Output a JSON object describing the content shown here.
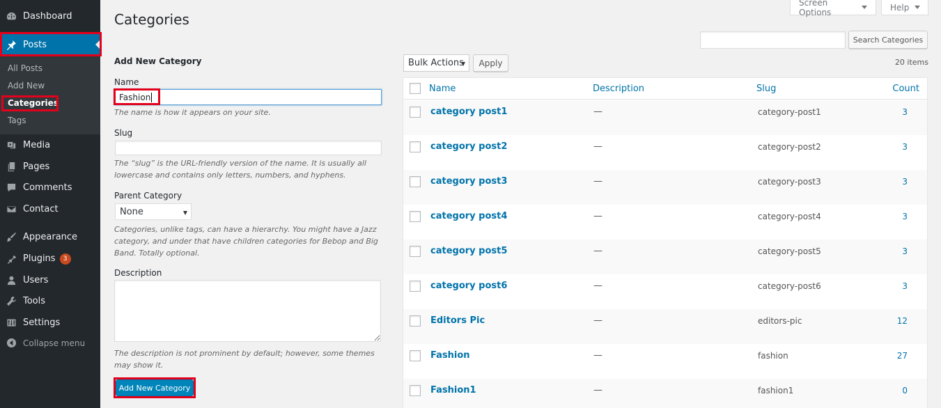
{
  "sidebar": {
    "dashboard": "Dashboard",
    "posts": "Posts",
    "submenu": [
      "All Posts",
      "Add New",
      "Categories",
      "Tags"
    ],
    "media": "Media",
    "pages": "Pages",
    "comments": "Comments",
    "contact": "Contact",
    "appearance": "Appearance",
    "plugins": "Plugins",
    "plugins_badge": "3",
    "users": "Users",
    "tools": "Tools",
    "settings": "Settings",
    "collapse": "Collapse menu"
  },
  "header": {
    "title": "Categories",
    "screen_options": "Screen Options",
    "help": "Help",
    "search_value": "",
    "search_button": "Search Categories"
  },
  "form": {
    "heading": "Add New Category",
    "name_label": "Name",
    "name_value": "Fashion",
    "name_help": "The name is how it appears on your site.",
    "slug_label": "Slug",
    "slug_value": "",
    "slug_help": "The “slug” is the URL-friendly version of the name. It is usually all lowercase and contains only letters, numbers, and hyphens.",
    "parent_label": "Parent Category",
    "parent_value": "None",
    "parent_help": "Categories, unlike tags, can have a hierarchy. You might have a Jazz category, and under that have children categories for Bebop and Big Band. Totally optional.",
    "description_label": "Description",
    "description_value": "",
    "description_help": "The description is not prominent by default; however, some themes may show it.",
    "submit": "Add New Category"
  },
  "table": {
    "bulk_actions": "Bulk Actions",
    "apply": "Apply",
    "items_count": "20 items",
    "columns": {
      "name": "Name",
      "description": "Description",
      "slug": "Slug",
      "count": "Count"
    },
    "rows": [
      {
        "name": "category post1",
        "description": "—",
        "slug": "category-post1",
        "count": "3"
      },
      {
        "name": "category post2",
        "description": "—",
        "slug": "category-post2",
        "count": "3"
      },
      {
        "name": "category post3",
        "description": "—",
        "slug": "category-post3",
        "count": "3"
      },
      {
        "name": "category post4",
        "description": "—",
        "slug": "category-post4",
        "count": "3"
      },
      {
        "name": "category post5",
        "description": "—",
        "slug": "category-post5",
        "count": "3"
      },
      {
        "name": "category post6",
        "description": "—",
        "slug": "category-post6",
        "count": "3"
      },
      {
        "name": "Editors Pic",
        "description": "—",
        "slug": "editors-pic",
        "count": "12"
      },
      {
        "name": "Fashion",
        "description": "—",
        "slug": "fashion",
        "count": "27"
      },
      {
        "name": "Fashion1",
        "description": "—",
        "slug": "fashion1",
        "count": "0"
      }
    ]
  }
}
